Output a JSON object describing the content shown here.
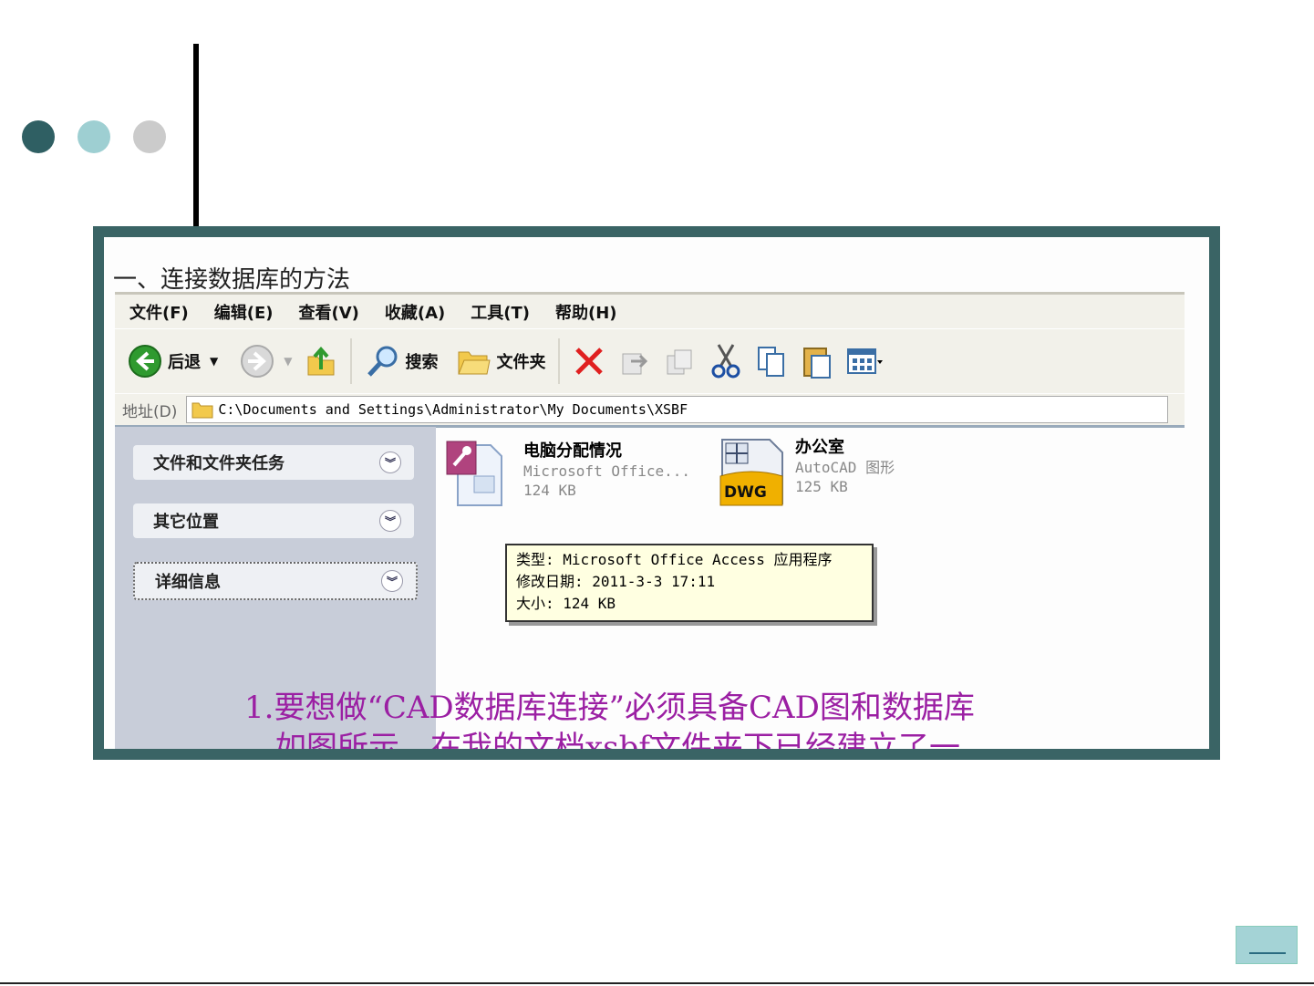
{
  "slide": {
    "dots": [
      "#2f5f63",
      "#9ecfd2",
      "#cbcbcb"
    ]
  },
  "window": {
    "heading": "一、连接数据库的方法",
    "menu": [
      "文件(F)",
      "编辑(E)",
      "查看(V)",
      "收藏(A)",
      "工具(T)",
      "帮助(H)"
    ],
    "toolbar": {
      "back_label": "后退",
      "search_label": "搜索",
      "folders_label": "文件夹"
    },
    "address": {
      "label": "地址(D)",
      "path": "C:\\Documents and Settings\\Administrator\\My Documents\\XSBF"
    },
    "sidebar": {
      "panels": [
        "文件和文件夹任务",
        "其它位置",
        "详细信息"
      ]
    },
    "files": [
      {
        "name": "电脑分配情况",
        "type": "Microsoft Office...",
        "size": "124 KB"
      },
      {
        "name": "办公室",
        "type": "AutoCAD 图形",
        "size": "125 KB",
        "badge": "DWG"
      }
    ],
    "tooltip": {
      "type_line": "类型: Microsoft Office Access 应用程序",
      "date_line": "修改日期: 2011-3-3 17:11",
      "size_line": "大小: 124 KB"
    }
  },
  "caption": {
    "line1": "1.要想做“CAD数据库连接”必须具备CAD图和数据库",
    "line2": "。如图所示，在我的文档xsbf文件夹下已经建立了一"
  }
}
